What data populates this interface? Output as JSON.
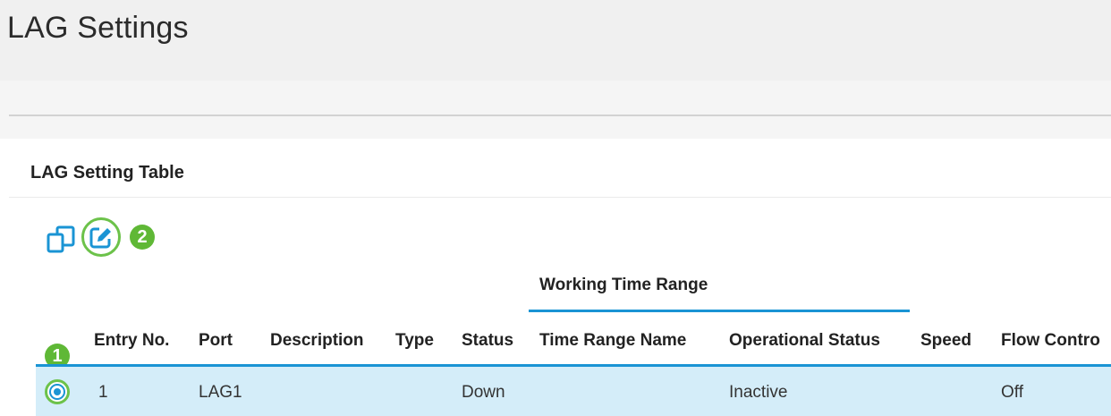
{
  "page": {
    "title": "LAG Settings"
  },
  "section": {
    "title": "LAG Setting Table"
  },
  "toolbar": {
    "copy_icon": "copy-settings-icon",
    "edit_icon": "edit-icon",
    "step_badge_2": "2"
  },
  "table": {
    "group_header": "Working Time Range",
    "columns": [
      "Entry No.",
      "Port",
      "Description",
      "Type",
      "Status",
      "Time Range Name",
      "Operational Status",
      "Speed",
      "Flow Contro"
    ],
    "step_badge_1": "1",
    "rows": [
      {
        "entry_no": "1",
        "port": "LAG1",
        "description": "",
        "type": "",
        "status": "Down",
        "time_range_name": "",
        "operational_status": "Inactive",
        "speed": "",
        "flow_control": "Off",
        "selected": true
      }
    ]
  },
  "colors": {
    "accent_blue": "#1a94d4",
    "highlight_green": "#6cc24a",
    "selected_row": "#d4edf9"
  }
}
